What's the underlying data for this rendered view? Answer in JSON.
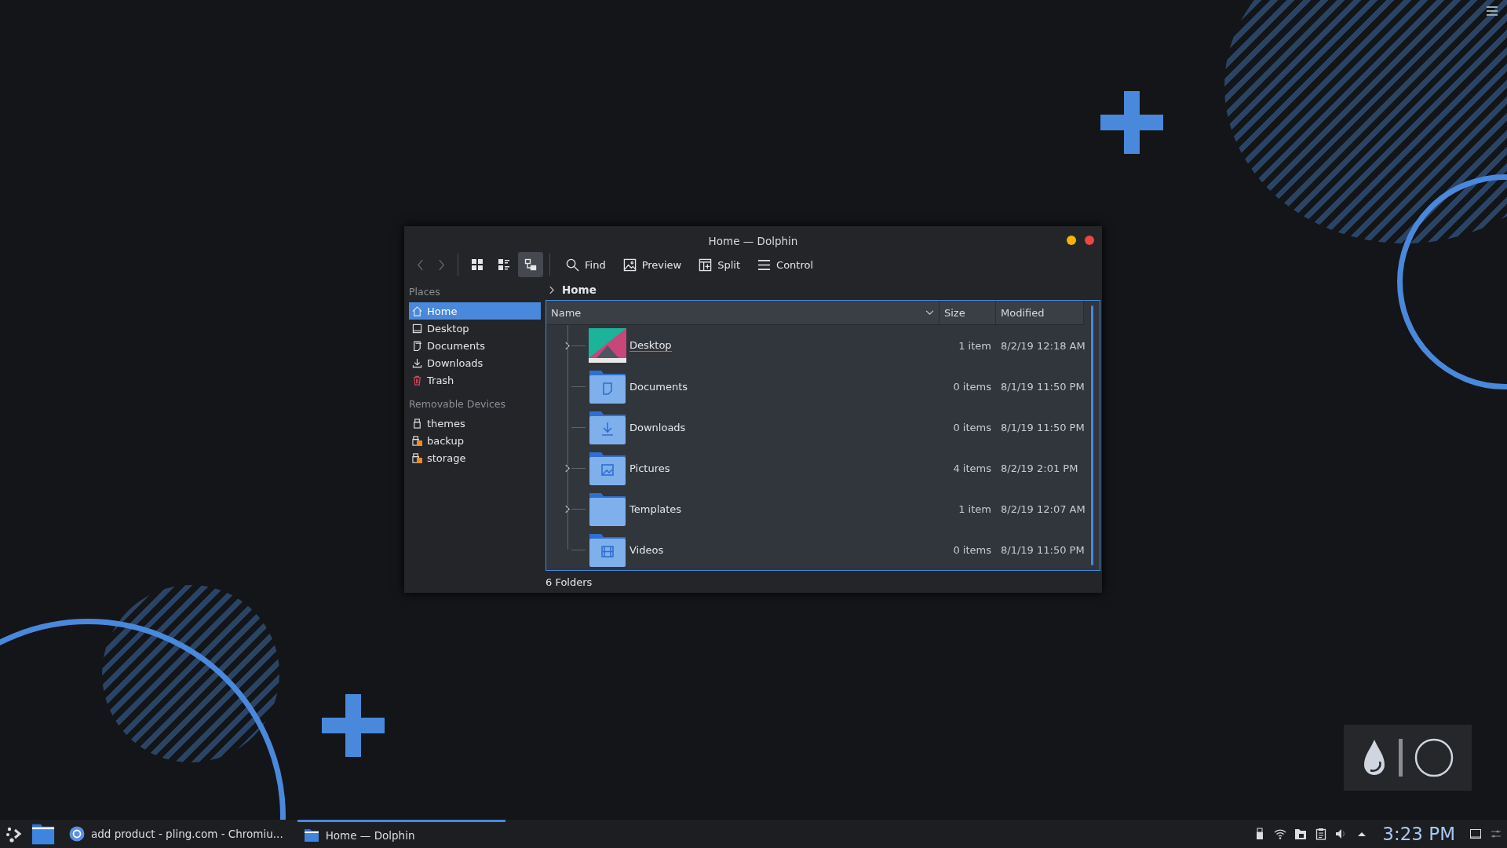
{
  "window": {
    "title": "Home — Dolphin",
    "controls": [
      {
        "color": "#f4b400"
      },
      {
        "color": "#ef4444"
      }
    ]
  },
  "toolbar": {
    "navigation": [
      {
        "kind": "back",
        "disabled": true
      },
      {
        "kind": "forward",
        "disabled": true
      }
    ],
    "view_modes": [
      {
        "kind": "icons",
        "selected": false
      },
      {
        "kind": "compact",
        "selected": false
      },
      {
        "kind": "details",
        "selected": true
      }
    ],
    "actions": [
      {
        "kind": "find",
        "label": "Find"
      },
      {
        "kind": "preview",
        "label": "Preview"
      },
      {
        "kind": "split",
        "label": "Split"
      },
      {
        "kind": "menu",
        "label": "Control"
      }
    ]
  },
  "sidebar": {
    "sections": [
      {
        "title": "Places",
        "items": [
          {
            "label": "Home",
            "kind": "home",
            "selected": true
          },
          {
            "label": "Desktop",
            "kind": "desktop",
            "selected": false
          },
          {
            "label": "Documents",
            "kind": "documents",
            "selected": false
          },
          {
            "label": "Downloads",
            "kind": "downloads",
            "selected": false
          },
          {
            "label": "Trash",
            "kind": "trash",
            "selected": false
          }
        ]
      },
      {
        "title": "Removable Devices",
        "items": [
          {
            "label": "themes",
            "kind": "drive",
            "selected": false
          },
          {
            "label": "backup",
            "kind": "drive-unmounted",
            "selected": false
          },
          {
            "label": "storage",
            "kind": "drive-unmounted",
            "selected": false
          }
        ]
      }
    ]
  },
  "breadcrumb": [
    "Home"
  ],
  "table": {
    "columns": [
      "Name",
      "Size",
      "Modified"
    ],
    "rows": [
      {
        "name": "Desktop",
        "size": "1 item",
        "modified": "8/2/19 12:18 AM",
        "kind": "wallpaper",
        "expandable": true,
        "hovered": true
      },
      {
        "name": "Documents",
        "size": "0 items",
        "modified": "8/1/19 11:50 PM",
        "kind": "documents",
        "expandable": false,
        "hovered": false
      },
      {
        "name": "Downloads",
        "size": "0 items",
        "modified": "8/1/19 11:50 PM",
        "kind": "downloads",
        "expandable": false,
        "hovered": false
      },
      {
        "name": "Pictures",
        "size": "4 items",
        "modified": "8/2/19 2:01 PM",
        "kind": "pictures",
        "expandable": true,
        "hovered": false
      },
      {
        "name": "Templates",
        "size": "1 item",
        "modified": "8/2/19 12:07 AM",
        "kind": "plain",
        "expandable": true,
        "hovered": false
      },
      {
        "name": "Videos",
        "size": "0 items",
        "modified": "8/1/19 11:50 PM",
        "kind": "videos",
        "expandable": false,
        "hovered": false
      }
    ]
  },
  "status_bar": "6 Folders",
  "taskbar": {
    "tasks": [
      {
        "label": "add product - pling.com - Chromiu...",
        "kind": "browser",
        "selected": false
      },
      {
        "label": "Home — Dolphin",
        "kind": "files",
        "selected": true
      }
    ],
    "clock": "3:23 PM"
  }
}
